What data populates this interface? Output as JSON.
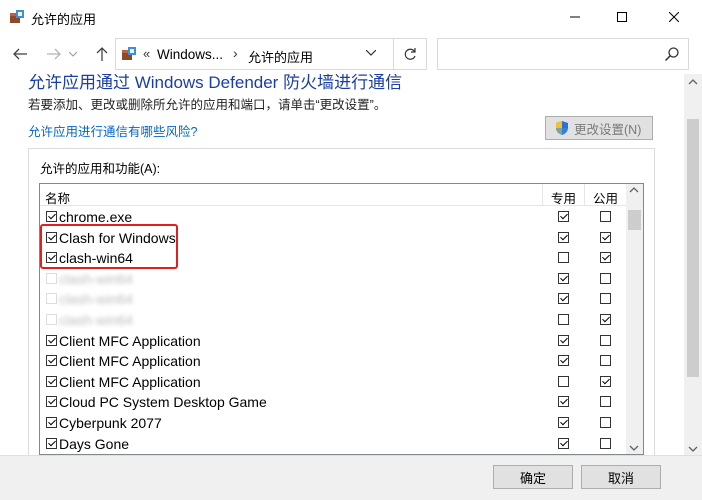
{
  "window": {
    "title": "允许的应用"
  },
  "address": {
    "prefix": "«",
    "segment1": "Windows...",
    "separator": "›",
    "segment2": "允许的应用",
    "search_placeholder": ""
  },
  "main": {
    "heading": "允许应用通过 Windows Defender 防火墙进行通信",
    "description": "若要添加、更改或删除所允许的应用和端口，请单击“更改设置”。",
    "risk_link": "允许应用进行通信有哪些风险?",
    "change_settings": "更改设置(N)",
    "group_label": "允许的应用和功能(A):"
  },
  "list": {
    "col_name": "名称",
    "col_private": "专用",
    "col_public": "公用",
    "rows": [
      {
        "name": "chrome.exe",
        "enabled": true,
        "private": true,
        "public": false,
        "blurred": false
      },
      {
        "name": "Clash for Windows",
        "enabled": true,
        "private": true,
        "public": true,
        "blurred": false
      },
      {
        "name": "clash-win64",
        "enabled": true,
        "private": false,
        "public": true,
        "blurred": false
      },
      {
        "name": "clash-win64",
        "enabled": false,
        "private": true,
        "public": false,
        "blurred": true
      },
      {
        "name": "clash-win64",
        "enabled": false,
        "private": true,
        "public": false,
        "blurred": true
      },
      {
        "name": "clash-win64",
        "enabled": false,
        "private": false,
        "public": true,
        "blurred": true
      },
      {
        "name": "Client MFC Application",
        "enabled": true,
        "private": true,
        "public": false,
        "blurred": false
      },
      {
        "name": "Client MFC Application",
        "enabled": true,
        "private": true,
        "public": false,
        "blurred": false
      },
      {
        "name": "Client MFC Application",
        "enabled": true,
        "private": false,
        "public": true,
        "blurred": false
      },
      {
        "name": "Cloud PC System Desktop Game",
        "enabled": true,
        "private": true,
        "public": false,
        "blurred": false
      },
      {
        "name": "Cyberpunk 2077",
        "enabled": true,
        "private": true,
        "public": false,
        "blurred": false
      },
      {
        "name": "Days Gone",
        "enabled": true,
        "private": true,
        "public": false,
        "blurred": false
      }
    ]
  },
  "footer": {
    "ok": "确定",
    "cancel": "取消"
  },
  "colors": {
    "heading": "#1a3ea8",
    "link": "#0066cc",
    "highlight": "#e02020"
  }
}
